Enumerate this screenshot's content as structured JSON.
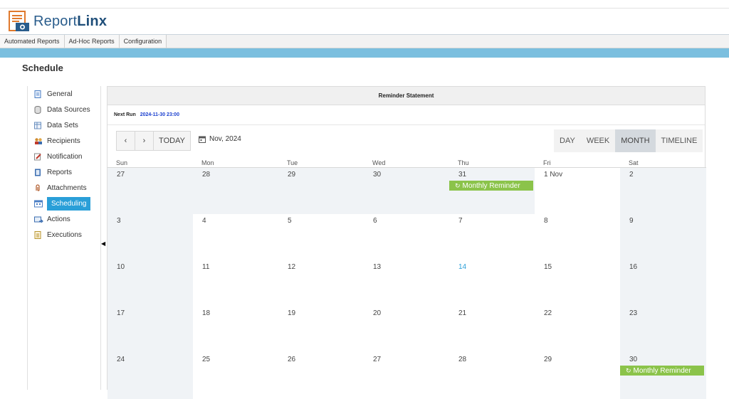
{
  "app": {
    "name_prefix": "Report",
    "name_bold": "Linx"
  },
  "menubar": {
    "items": [
      "Automated Reports",
      "Ad-Hoc Reports",
      "Configuration"
    ]
  },
  "page": {
    "title": "Schedule"
  },
  "sidebar": {
    "items": [
      {
        "label": "General",
        "icon": "document-icon",
        "color": "#4a7ec4"
      },
      {
        "label": "Data Sources",
        "icon": "database-icon",
        "color": "#777777"
      },
      {
        "label": "Data Sets",
        "icon": "table-icon",
        "color": "#6a8fbf"
      },
      {
        "label": "Recipients",
        "icon": "users-icon",
        "color": "#d08a2e"
      },
      {
        "label": "Notification",
        "icon": "edit-icon",
        "color": "#c0392b"
      },
      {
        "label": "Reports",
        "icon": "book-icon",
        "color": "#3b6db0"
      },
      {
        "label": "Attachments",
        "icon": "paperclip-icon",
        "color": "#b05a2a"
      },
      {
        "label": "Scheduling",
        "icon": "calendar-icon",
        "color": "#4a7ec4",
        "active": true
      },
      {
        "label": "Actions",
        "icon": "actions-icon",
        "color": "#3b6db0"
      },
      {
        "label": "Executions",
        "icon": "list-icon",
        "color": "#b8962e"
      }
    ]
  },
  "calendar": {
    "title": "Reminder Statement",
    "next_run_label": "Next Run",
    "next_run_value": "2024-11-30 23:00",
    "nav": {
      "prev": "‹",
      "next": "›",
      "today": "TODAY"
    },
    "current_period": "Nov, 2024",
    "views": [
      "DAY",
      "WEEK",
      "MONTH",
      "TIMELINE"
    ],
    "active_view": "MONTH",
    "weekdays": [
      "Sun",
      "Mon",
      "Tue",
      "Wed",
      "Thu",
      "Fri",
      "Sat"
    ],
    "weeks": [
      [
        "27",
        "28",
        "29",
        "30",
        "31",
        "1 Nov",
        "2"
      ],
      [
        "3",
        "4",
        "5",
        "6",
        "7",
        "8",
        "9"
      ],
      [
        "10",
        "11",
        "12",
        "13",
        "14",
        "15",
        "16"
      ],
      [
        "17",
        "18",
        "19",
        "20",
        "21",
        "22",
        "23"
      ],
      [
        "24",
        "25",
        "26",
        "27",
        "28",
        "29",
        "30"
      ]
    ],
    "today": "14",
    "events": [
      {
        "week": 0,
        "day": 4,
        "label": "Monthly Reminder"
      },
      {
        "week": 4,
        "day": 6,
        "label": "Monthly Reminder"
      }
    ],
    "colors": {
      "event": "#8bc34a",
      "accent": "#2a9fd8",
      "next_run": "#1a3fcf"
    }
  }
}
